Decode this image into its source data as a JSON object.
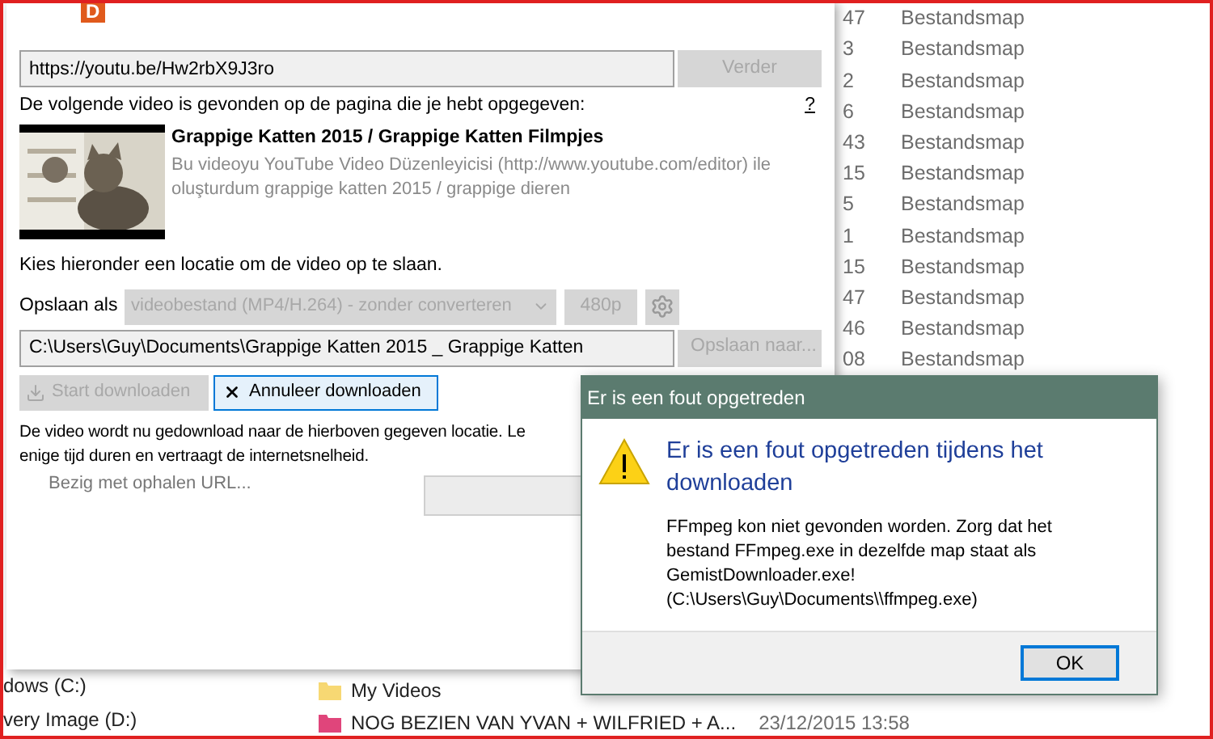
{
  "explorer": {
    "rows": [
      {
        "column_1": "47",
        "type": "Bestandsmap"
      },
      {
        "column_1": "3",
        "type": "Bestandsmap"
      },
      {
        "column_1": "2",
        "type": "Bestandsmap"
      },
      {
        "column_1": "6",
        "type": "Bestandsmap"
      },
      {
        "column_1": "43",
        "type": "Bestandsmap"
      },
      {
        "column_1": "15",
        "type": "Bestandsmap"
      },
      {
        "column_1": "5",
        "type": "Bestandsmap"
      },
      {
        "column_1": "1",
        "type": "Bestandsmap"
      },
      {
        "column_1": "15",
        "type": "Bestandsmap"
      },
      {
        "column_1": "47",
        "type": "Bestandsmap"
      },
      {
        "column_1": "46",
        "type": "Bestandsmap"
      },
      {
        "column_1": "08",
        "type": "Bestandsmap"
      }
    ],
    "drives": [
      "dows (C:)",
      "very Image (D:)"
    ],
    "files": [
      {
        "name": "My Videos",
        "color": "#f7d873"
      },
      {
        "name": "NOG BEZIEN VAN YVAN + WILFRIED + A...",
        "color": "#e0457b",
        "date": "23/12/2015 13:58"
      }
    ]
  },
  "downloader": {
    "logo": "D",
    "url": "https://youtu.be/Hw2rbX9J3ro",
    "next_button": {
      "label": "Verder",
      "disabled": true
    },
    "found_text": "De volgende video is gevonden op de pagina die je hebt opgegeven:",
    "help": "?",
    "video": {
      "kind": "picture",
      "title": "Grappige Katten 2015 / Grappige Katten Filmpjes",
      "description": "Bu videoyu YouTube Video Düzenleyicisi (http://www.youtube.com/editor) ile oluşturdum grappige katten 2015 / grappige dieren"
    },
    "choose_text": "Kies hieronder een locatie om de video op te slaan.",
    "save_as_label": "Opslaan als",
    "format": "videobestand (MP4/H.264) - zonder converteren",
    "quality": "480p",
    "path": "C:\\Users\\Guy\\Documents\\Grappige Katten 2015 _ Grappige Katten",
    "save_to_button": {
      "label": "Opslaan naar...",
      "disabled": true
    },
    "start_button": {
      "label": "Start downloaden",
      "disabled": true
    },
    "cancel_button": {
      "label": "Annuleer downloaden",
      "disabled": false
    },
    "info_lines": [
      "De video wordt nu gedownload naar de hierboven gegeven locatie. Le",
      "enige tijd duren en vertraagt de internetsnelheid."
    ],
    "status": "Bezig met ophalen URL..."
  },
  "error_dialog": {
    "title": "Er is een fout opgetreden",
    "heading": "Er is een fout opgetreden tijdens het downloaden",
    "message_lines": [
      "FFmpeg kon niet gevonden worden. Zorg dat het",
      "bestand FFmpeg.exe in dezelfde map staat als",
      "GemistDownloader.exe!",
      "(C:\\Users\\Guy\\Documents\\\\ffmpeg.exe)"
    ],
    "ok_button": "OK"
  }
}
